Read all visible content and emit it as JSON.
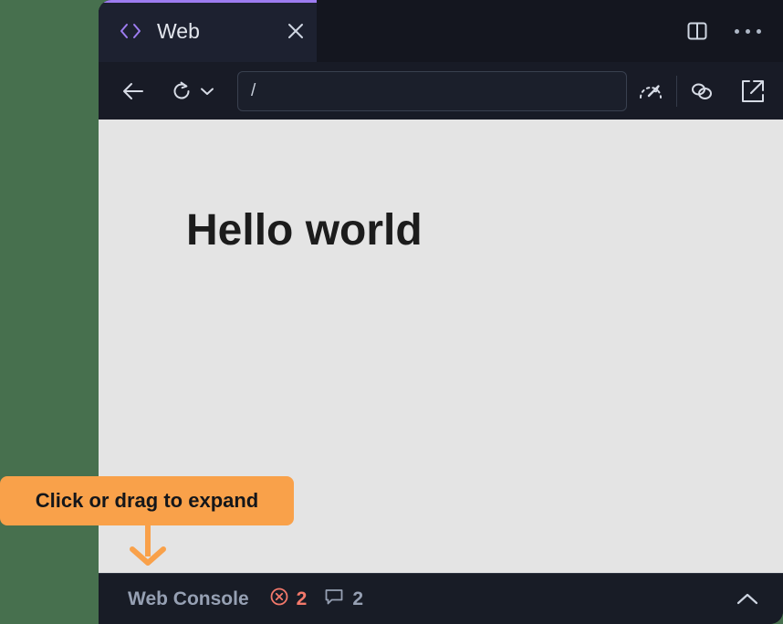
{
  "backdrop": {
    "color": "#47704e"
  },
  "window": {
    "tab": {
      "icon": "code-brackets-icon",
      "title": "Web",
      "close_icon": "close-icon",
      "accent_color": "#9d7cf0"
    },
    "tabstrip_actions": [
      {
        "name": "split-pane-icon",
        "label": "Split pane"
      },
      {
        "name": "overflow-menu-icon",
        "label": "More options"
      }
    ],
    "toolbar": {
      "back": "back-arrow-icon",
      "reload": "reload-icon",
      "reload_menu": "chevron-down-icon",
      "url_value": "/",
      "url_placeholder": "/",
      "actions": [
        {
          "name": "performance-gauge-icon",
          "label": "Performance"
        },
        {
          "name": "link-chain-icon",
          "label": "Copy link"
        },
        {
          "name": "open-external-icon",
          "label": "Open in browser"
        }
      ]
    },
    "viewport": {
      "background": "#e4e4e4",
      "heading": "Hello world"
    },
    "console": {
      "title": "Web Console",
      "errors": {
        "icon": "error-circle-icon",
        "count": "2",
        "color": "#f4796b"
      },
      "messages": {
        "icon": "message-bubble-icon",
        "count": "2",
        "color": "#96a0b3"
      },
      "expand_icon": "chevron-up-icon"
    }
  },
  "annotation": {
    "text": "Click or drag to expand",
    "color": "#f9a14a",
    "arrow": "down-arrow-icon"
  }
}
